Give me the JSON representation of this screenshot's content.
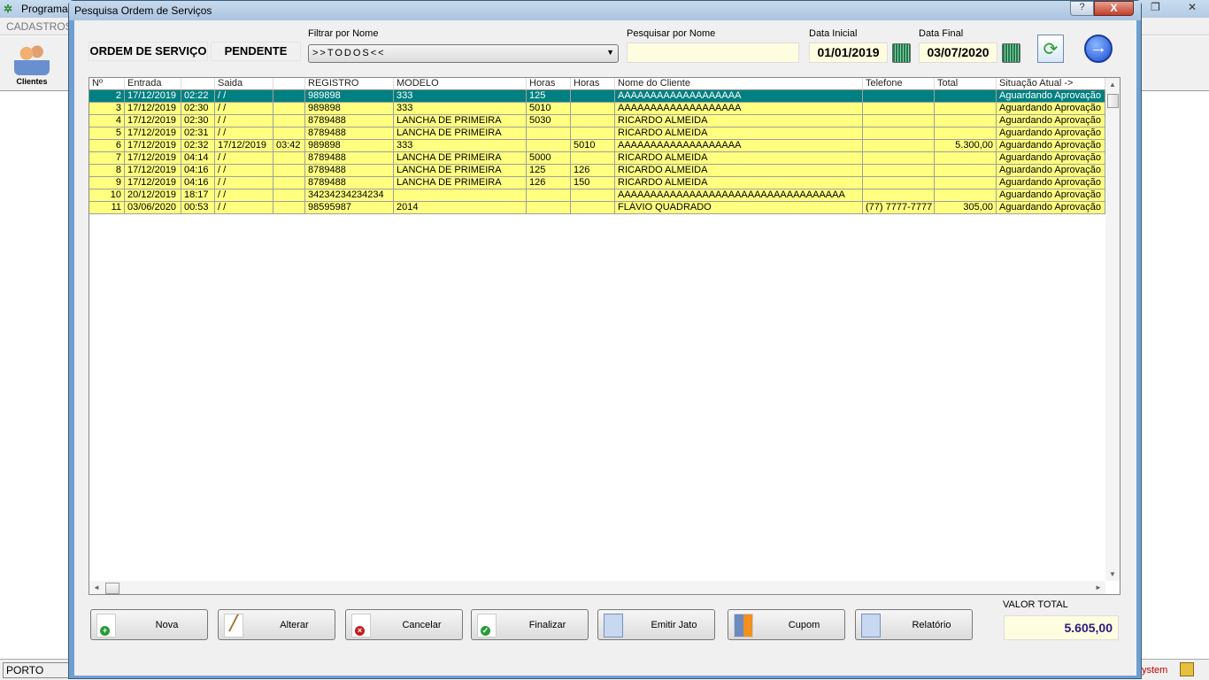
{
  "app": {
    "title": "Programa",
    "menu_first": "CADASTROS",
    "toolbar_clientes": "Clientes",
    "status_city": "PORTO ALEG",
    "status_system": "ystem"
  },
  "dialog": {
    "title": "Pesquisa Ordem de Serviços",
    "help": "?",
    "close": "X"
  },
  "header": {
    "ordem_label": "ORDEM DE SERVIÇO",
    "status_label": "PENDENTE",
    "filter_label": "Filtrar por Nome",
    "filter_value": ">>TODOS<<",
    "search_label": "Pesquisar por Nome",
    "search_value": "",
    "data_inicial_label": "Data Inicial",
    "data_inicial": "01/01/2019",
    "data_final_label": "Data Final",
    "data_final": "03/07/2020"
  },
  "grid": {
    "columns": [
      "Nº",
      "Entrada",
      "",
      "Saida",
      "",
      "REGISTRO",
      "MODELO",
      "Horas",
      "Horas",
      "Nome do Cliente",
      "Telefone",
      "Total",
      "Situação Atual ->"
    ],
    "rows": [
      [
        "2",
        "17/12/2019",
        "02:22",
        " /  /",
        "",
        "989898",
        "333",
        "125",
        "",
        "AAAAAAAAAAAAAAAAAAA",
        "",
        "",
        "Aguardando Aprovação"
      ],
      [
        "3",
        "17/12/2019",
        "02:30",
        " /  /",
        "",
        "989898",
        "333",
        "5010",
        "",
        "AAAAAAAAAAAAAAAAAAA",
        "",
        "",
        "Aguardando Aprovação"
      ],
      [
        "4",
        "17/12/2019",
        "02:30",
        " /  /",
        "",
        "8789488",
        "LANCHA DE PRIMEIRA",
        "5030",
        "",
        "RICARDO ALMEIDA",
        "",
        "",
        "Aguardando Aprovação"
      ],
      [
        "5",
        "17/12/2019",
        "02:31",
        " /  /",
        "",
        "8789488",
        "LANCHA DE PRIMEIRA",
        "",
        "",
        "RICARDO ALMEIDA",
        "",
        "",
        "Aguardando Aprovação"
      ],
      [
        "6",
        "17/12/2019",
        "02:32",
        "17/12/2019",
        "03:42",
        "989898",
        "333",
        "",
        "5010",
        "AAAAAAAAAAAAAAAAAAA",
        "",
        "5.300,00",
        "Aguardando Aprovação"
      ],
      [
        "7",
        "17/12/2019",
        "04:14",
        " /  /",
        "",
        "8789488",
        "LANCHA DE PRIMEIRA",
        "5000",
        "",
        "RICARDO ALMEIDA",
        "",
        "",
        "Aguardando Aprovação"
      ],
      [
        "8",
        "17/12/2019",
        "04:16",
        " /  /",
        "",
        "8789488",
        "LANCHA DE PRIMEIRA",
        "125",
        "126",
        "RICARDO ALMEIDA",
        "",
        "",
        "Aguardando Aprovação"
      ],
      [
        "9",
        "17/12/2019",
        "04:16",
        " /  /",
        "",
        "8789488",
        "LANCHA DE PRIMEIRA",
        "126",
        "150",
        "RICARDO ALMEIDA",
        "",
        "",
        "Aguardando Aprovação"
      ],
      [
        "10",
        "20/12/2019",
        "18:17",
        " /  /",
        "",
        "34234234234234",
        "",
        "",
        "",
        "AAAAAAAAAAAAAAAAAAAAAAAAAAAAAAAAAAA",
        "",
        "",
        "Aguardando Aprovação"
      ],
      [
        "11",
        "03/06/2020",
        "00:53",
        " /  /",
        "",
        "98595987",
        "2014",
        "",
        "",
        "FLÁVIO QUADRADO",
        "(77) 7777-7777",
        "305,00",
        "Aguardando Aprovação"
      ]
    ],
    "selected_row": 0
  },
  "buttons": {
    "nova": "Nova",
    "alterar": "Alterar",
    "cancelar": "Cancelar",
    "finalizar": "Finalizar",
    "emitir_jato": "Emitir Jato",
    "cupom": "Cupom",
    "relatorio": "Relatório"
  },
  "total": {
    "label": "VALOR TOTAL",
    "value": "5.605,00"
  },
  "colors": {
    "row_bg": "#ffff80",
    "selected_bg": "#008080",
    "total_text": "#2a1a80"
  }
}
